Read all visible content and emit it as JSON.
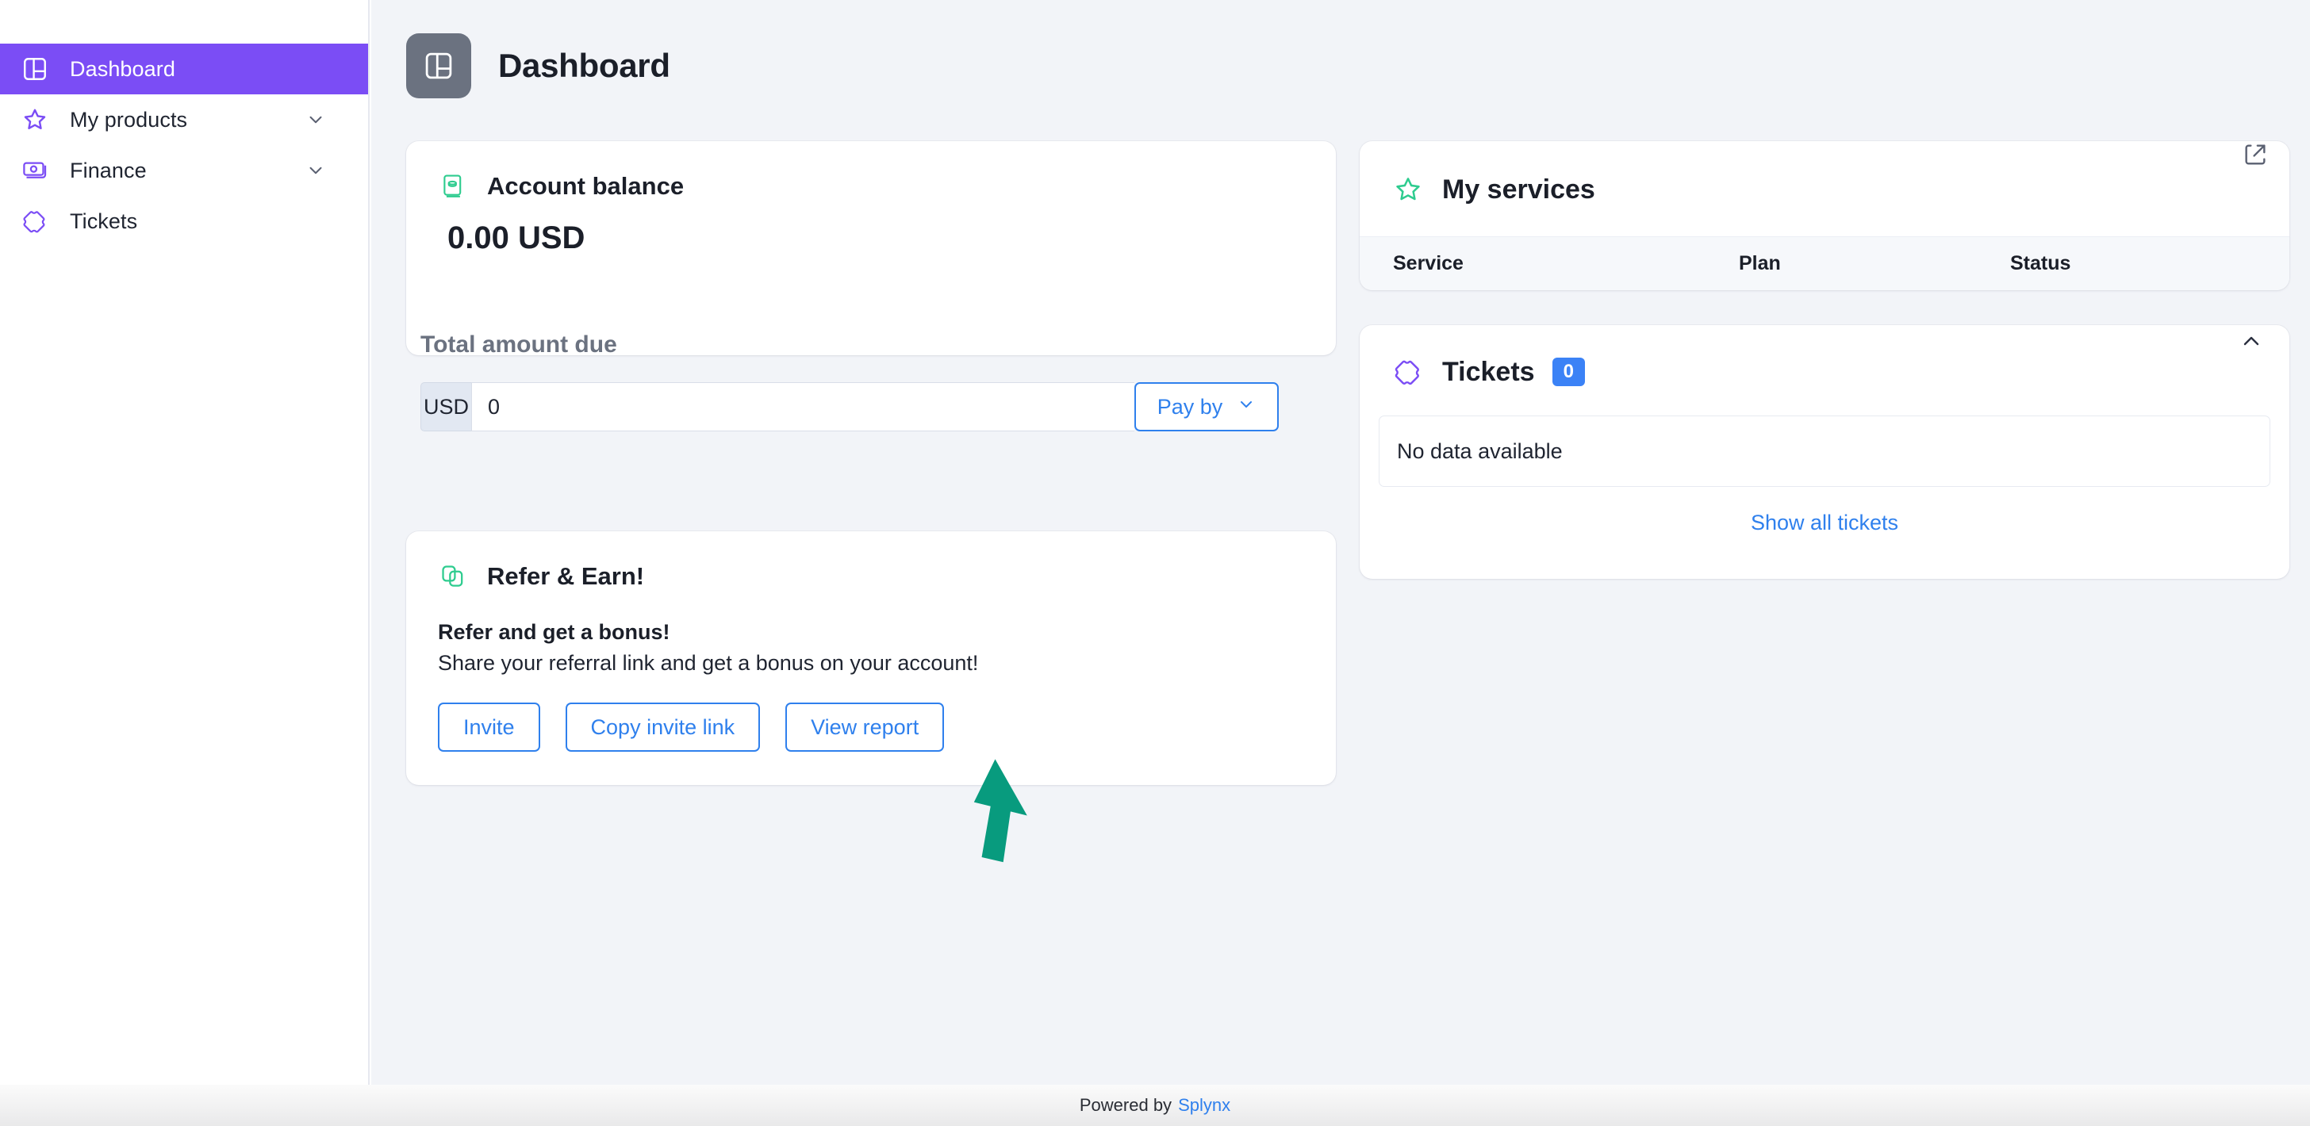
{
  "colors": {
    "sidebar_active": "#7B4DF5",
    "accent_blue": "#2F80ED",
    "accent_green": "#2ECC8F",
    "badge_blue": "#3B82F6",
    "header_badge_gray": "#6B7280",
    "annotation_green": "#089B7E"
  },
  "sidebar": {
    "items": [
      {
        "label": "Dashboard",
        "icon": "dashboard-grid-icon",
        "active": true,
        "expandable": false
      },
      {
        "label": "My products",
        "icon": "star-icon",
        "active": false,
        "expandable": true
      },
      {
        "label": "Finance",
        "icon": "banknote-icon",
        "active": false,
        "expandable": true
      },
      {
        "label": "Tickets",
        "icon": "ticket-icon",
        "active": false,
        "expandable": false
      }
    ]
  },
  "header": {
    "title": "Dashboard",
    "icon": "dashboard-grid-icon"
  },
  "account_balance": {
    "title": "Account balance",
    "icon": "money-stack-icon",
    "value": "0.00 USD"
  },
  "amount_due": {
    "label": "Total amount due",
    "currency_prefix": "USD",
    "amount_value": "0",
    "amount_placeholder": "0",
    "pay_by_label": "Pay by",
    "pay_by_icon": "chevron-down-icon"
  },
  "refer": {
    "title": "Refer & Earn!",
    "icon": "copy-link-icon",
    "subtitle": "Refer and get a bonus!",
    "description": "Share your referral link and get a bonus on your account!",
    "buttons": [
      {
        "label": "Invite"
      },
      {
        "label": "Copy invite link"
      },
      {
        "label": "View report"
      }
    ]
  },
  "my_services": {
    "title": "My services",
    "icon": "star-icon",
    "external_icon": "external-link-icon",
    "columns": [
      "Service",
      "Plan",
      "Status"
    ],
    "rows": []
  },
  "tickets": {
    "title": "Tickets",
    "icon": "ticket-icon",
    "count": "0",
    "collapse_icon": "chevron-up-icon",
    "empty_text": "No data available",
    "show_all_label": "Show all tickets"
  },
  "footer": {
    "powered_by": "Powered by",
    "brand": "Splynx"
  },
  "annotation": {
    "type": "arrow",
    "points_to": "Copy invite link",
    "color": "#089B7E"
  }
}
